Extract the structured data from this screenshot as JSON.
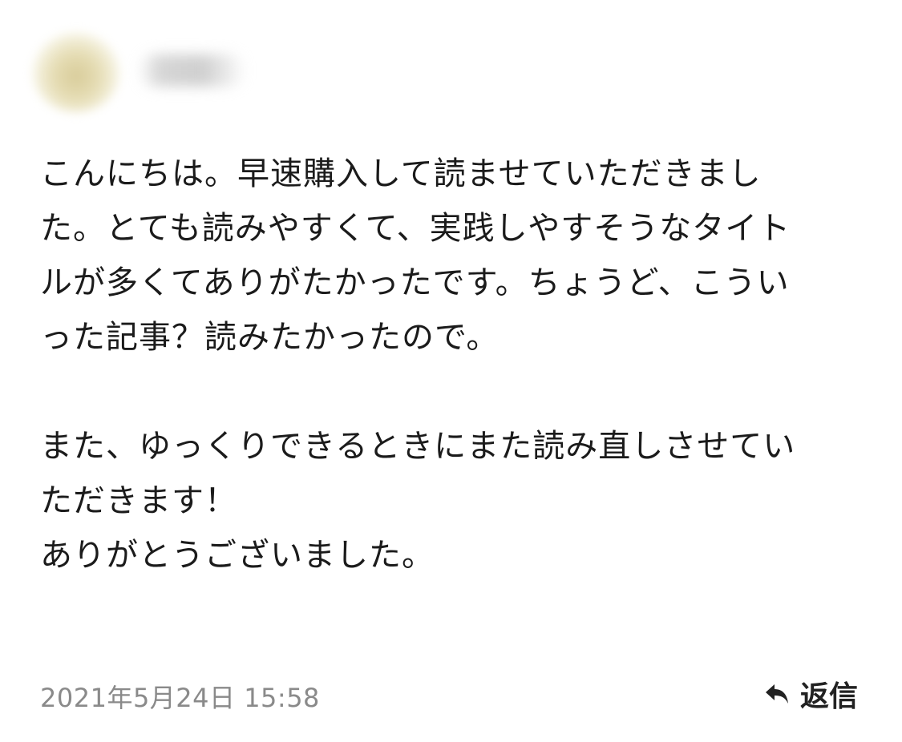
{
  "comment": {
    "paragraphs": [
      "こんにちは。早速購入して読ませていただきまし",
      "た。とても読みやすくて、実践しやすそうなタイト",
      "ルが多くてありがたかったです。ちょうど、こうい",
      "った記事？読みたかったので。",
      "",
      "また、ゆっくりできるときにまた読み直しさせてい",
      "ただきます！",
      "ありがとうございました。"
    ]
  },
  "footer": {
    "timestamp": "2021年5月24日 15:58",
    "reply_label": "返信",
    "reply_icon": "reply-arrow-icon"
  },
  "colors": {
    "text": "#1b1b1b",
    "timestamp": "#8a8a8a",
    "reply": "#222222"
  }
}
